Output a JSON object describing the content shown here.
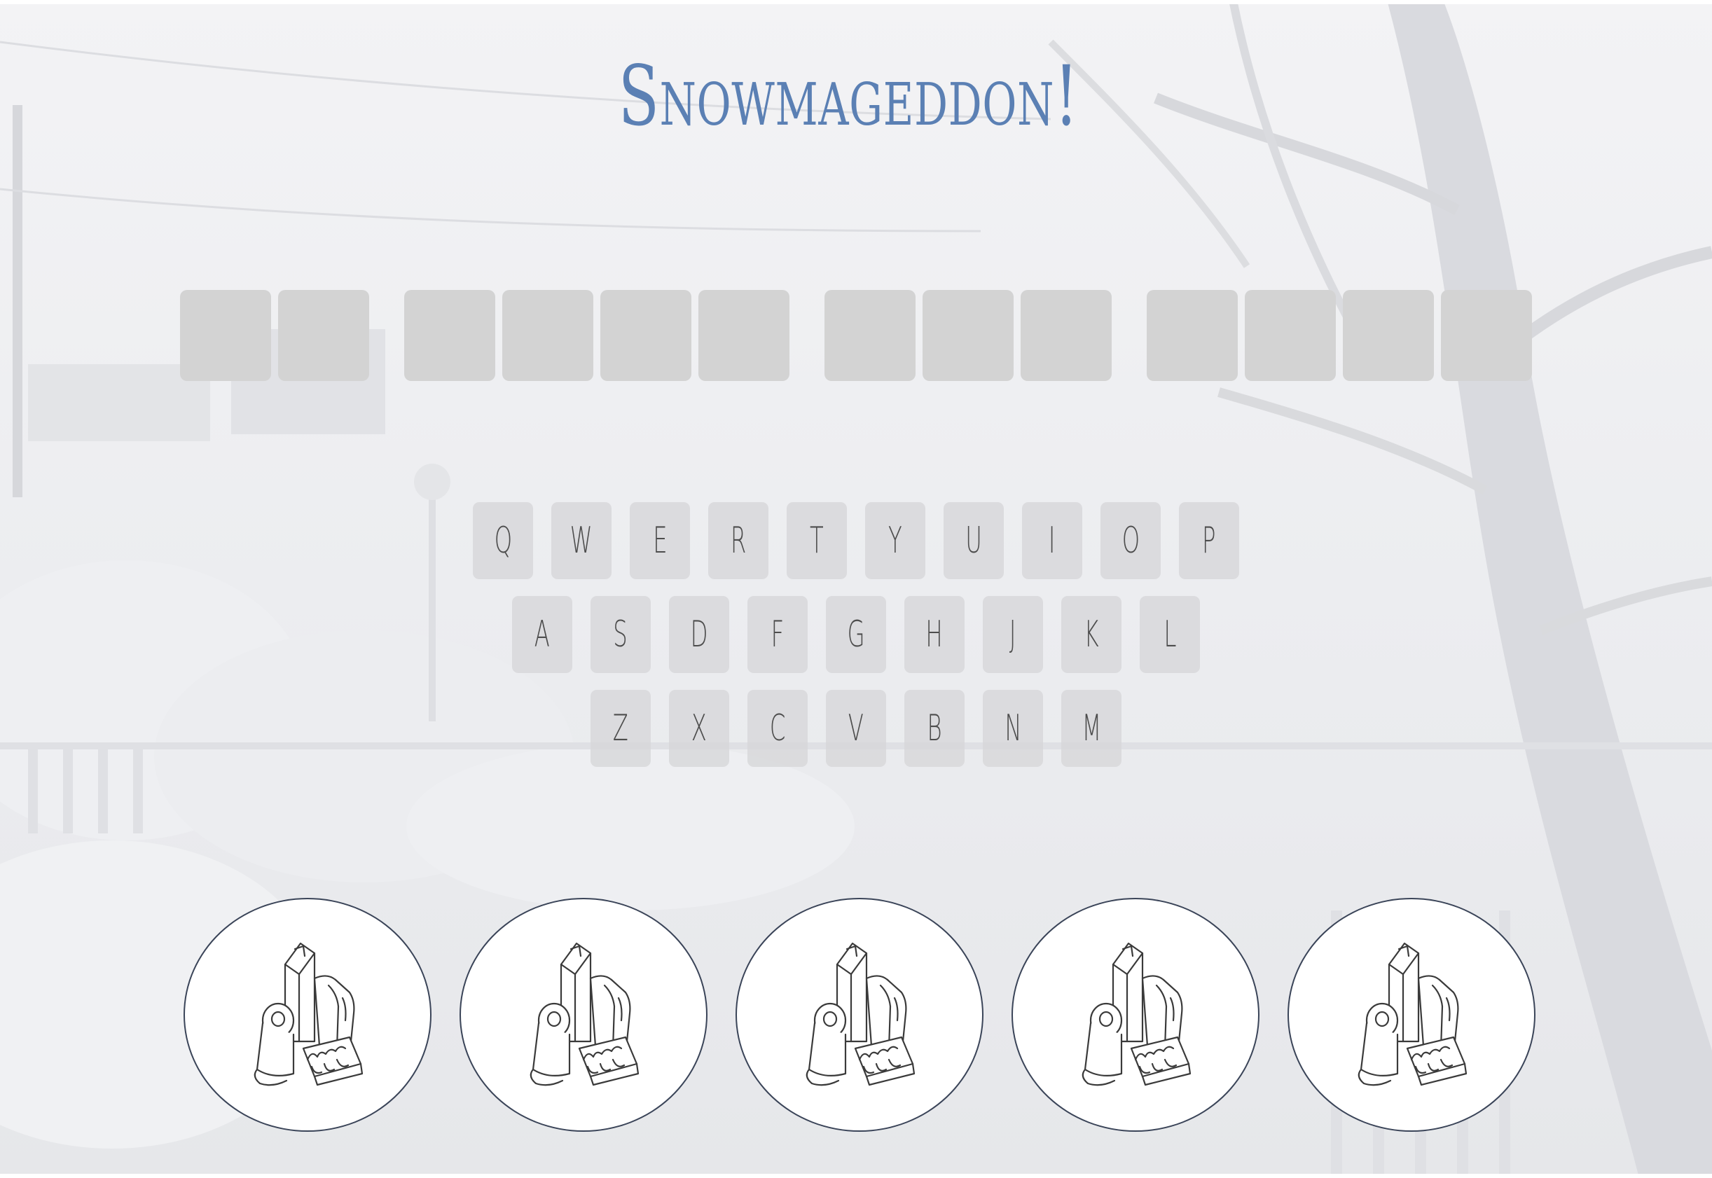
{
  "title": "Snowmageddon!",
  "board": {
    "words": [
      2,
      4,
      3,
      4
    ]
  },
  "keyboard": {
    "rows": [
      [
        "Q",
        "W",
        "E",
        "R",
        "T",
        "Y",
        "U",
        "I",
        "O",
        "P"
      ],
      [
        "A",
        "S",
        "D",
        "F",
        "G",
        "H",
        "J",
        "K",
        "L"
      ],
      [
        "Z",
        "X",
        "C",
        "V",
        "B",
        "N",
        "M"
      ]
    ]
  },
  "lives": {
    "count": 5,
    "icon": "groceries-icon"
  },
  "colors": {
    "title": "#5b80b4",
    "tile": "#d3d3d3",
    "background": "#e9eaed",
    "life_border": "#3a4458"
  }
}
